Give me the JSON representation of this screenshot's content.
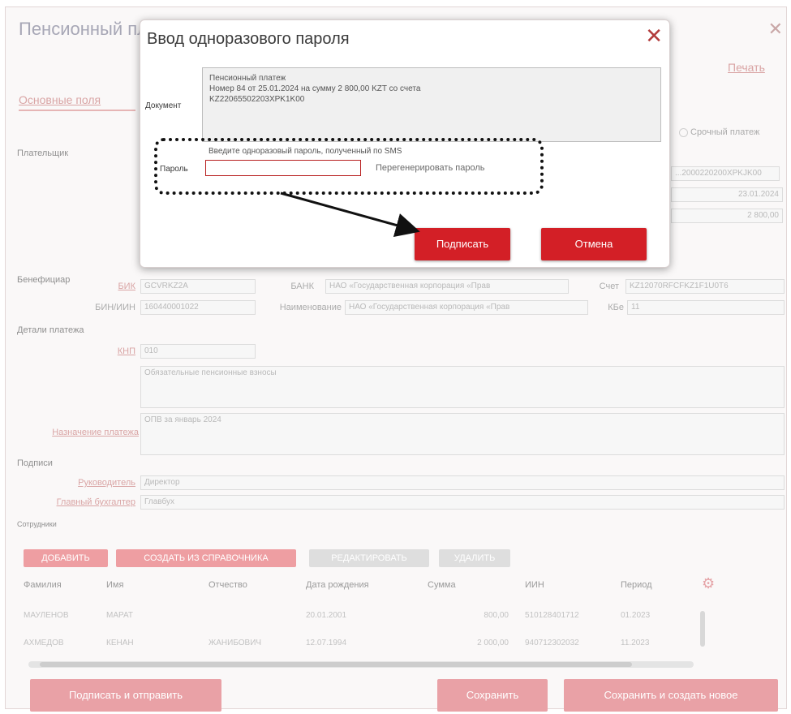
{
  "background": {
    "title": "Пенсионный платеж",
    "close_icon": "close-icon",
    "print_link": "Печать",
    "tab_main": "Основные поля",
    "urgent_payment": "Срочный платеж",
    "sections": {
      "payer": "Плательщик",
      "beneficiary": "Бенефициар",
      "payment_details": "Детали платежа",
      "signatures": "Подписи",
      "employees": "Сотрудники"
    },
    "payer_fields": {
      "account_value": "...​2000220200XPKJK00",
      "date_value": "23.01.2024",
      "amount_value": "2 800,00"
    },
    "beneficiary": {
      "bik_label": "БИК",
      "bik_value": "GCVRKZ2A",
      "bank_label": "БАНК",
      "bank_value": "НАО «Государственная корпорация «Прав",
      "account_label": "Счет",
      "account_value": "KZ12070RFCFKZ1F1U0T6",
      "bin_label": "БИН/ИИН",
      "bin_value": "160440001022",
      "name_label": "Наименование",
      "name_value": "НАО «Государственная корпорация «Прав",
      "kbe_label": "КБе",
      "kbe_value": "11"
    },
    "details": {
      "knp_label": "КНП",
      "knp_value": "010",
      "knp_desc": "Обязательные пенсионные взносы",
      "purpose_label": "Назначение платежа",
      "purpose_value": "ОПВ за январь 2024"
    },
    "signatures": {
      "head_label": "Руководитель",
      "head_value": "Директор",
      "accountant_label": "Главный бухгалтер",
      "accountant_value": "Главбух"
    },
    "table_buttons": [
      "ДОБАВИТЬ",
      "СОЗДАТЬ ИЗ СПРАВОЧНИКА",
      "РЕДАКТИРОВАТЬ",
      "УДАЛИТЬ"
    ],
    "columns": [
      "Фамилия",
      "Имя",
      "Отчество",
      "Дата рождения",
      "Сумма",
      "ИИН",
      "Период"
    ],
    "rows": [
      [
        "МАУЛЕНОВ",
        "МАРАТ",
        "",
        "20.01.2001",
        "800,00",
        "510128401712",
        "01.2023"
      ],
      [
        "АХМЕДОВ",
        "КЕНАН",
        "ЖАНИБОВИЧ",
        "12.07.1994",
        "2 000,00",
        "940712302032",
        "11.2023"
      ]
    ],
    "gear_icon": "gear-icon",
    "bottom_buttons": {
      "sign_send": "Подписать и отправить",
      "save": "Сохранить",
      "save_new": "Сохранить и создать новое"
    }
  },
  "dialog": {
    "title": "Ввод одноразового пароля",
    "document_label": "Документ",
    "document_text_line1": "Пенсионный платеж",
    "document_text_line2": "Номер 84 от 25.01.2024 на сумму 2 800,00 KZT со счета",
    "document_text_line3": "KZ22065502203XPK1K00",
    "password_hint": "Введите одноразовый пароль, полученный по SMS",
    "password_label": "Пароль",
    "password_value": "",
    "regenerate_link": "Перегенерировать пароль",
    "sign_button": "Подписать",
    "cancel_button": "Отмена"
  },
  "colors": {
    "accent": "#d31f26",
    "faded_accent": "#e9a1a6",
    "annotation": "#111111"
  }
}
